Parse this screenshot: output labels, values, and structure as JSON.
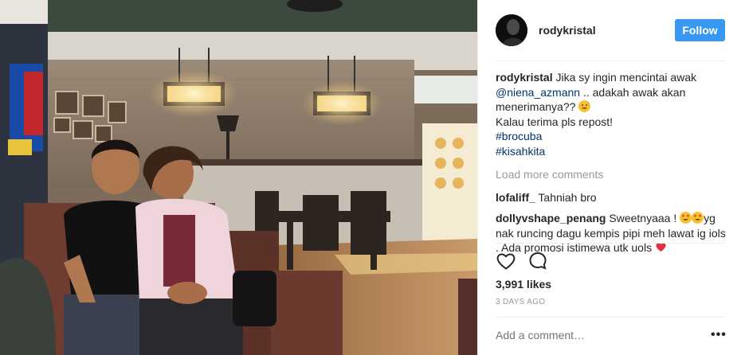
{
  "post": {
    "username": "rodykristal",
    "follow_label": "Follow",
    "caption": {
      "username": "rodykristal",
      "line1": "Jika sy ingin mencintai awak",
      "mention": "@niena_azmann",
      "line2": ".. adakah awak akan menerimanya??",
      "line3": "Kalau terima pls repost!",
      "hashtag1": "#brocuba",
      "hashtag2": "#kisahkita"
    },
    "load_more": "Load more comments",
    "comments": [
      {
        "username": "lofaliff_",
        "text": "Tahniah bro"
      },
      {
        "username": "dollyvshape_penang",
        "text_a": "Sweetnyaaa !",
        "text_b": "yg nak runcing dagu kempis pipi meh lawat ig iols . Ada promosi istimewa utk uols"
      }
    ],
    "likes": "3,991 likes",
    "time": "3 DAYS AGO",
    "add_comment_placeholder": "Add a comment…",
    "more_options": "•••"
  },
  "icons": {
    "like": "heart-outline-icon",
    "comment": "speech-bubble-icon",
    "options": "ellipsis-icon"
  },
  "colors": {
    "follow_button": "#3897f0",
    "link": "#003569",
    "muted": "#999999",
    "text": "#262626"
  }
}
